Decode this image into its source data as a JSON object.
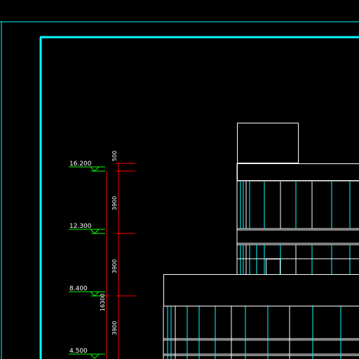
{
  "drawing": {
    "colors": {
      "background": "#000000",
      "frame": "#00ffff",
      "outline": "#ffffff",
      "elevation_marker": "#00ff00",
      "dimension_line": "#ff0000",
      "glazing": "#00ffff"
    },
    "elevation_levels": [
      "16.200",
      "12.300",
      "8.400",
      "4.500"
    ],
    "dimensions": {
      "parapet": "500",
      "floor_1": "3900",
      "floor_2": "3900",
      "floor_3": "3900",
      "total": "16300"
    }
  }
}
